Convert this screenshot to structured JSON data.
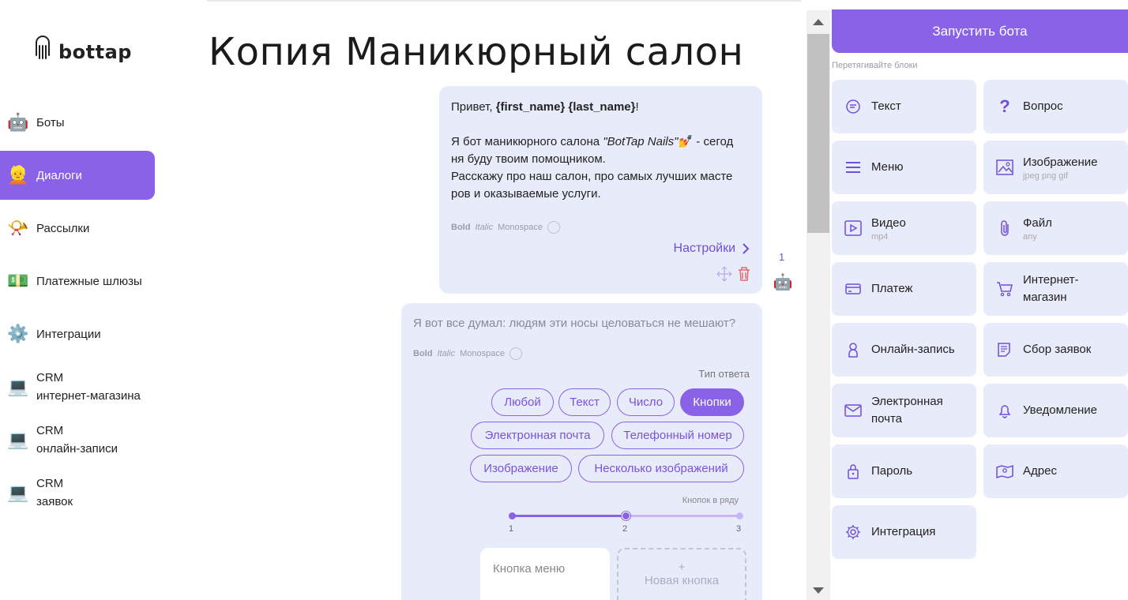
{
  "brand": {
    "name": "bottap"
  },
  "nav": {
    "items": [
      {
        "label": "Боты",
        "icon": "robot-icon"
      },
      {
        "label": "Диалоги",
        "icon": "person-icon",
        "active": true
      },
      {
        "label": "Рассылки",
        "icon": "postal-horn-icon"
      },
      {
        "label": "Платежные шлюзы",
        "icon": "money-icon"
      },
      {
        "label": "Интеграции",
        "icon": "gear-icon"
      },
      {
        "label1": "CRM",
        "label2": "интернет-магазина",
        "icon": "laptop-icon"
      },
      {
        "label1": "CRM",
        "label2": "онлайн-записи",
        "icon": "laptop-icon"
      },
      {
        "label1": "CRM",
        "label2": "заявок",
        "icon": "laptop-icon"
      }
    ]
  },
  "page": {
    "title": "Копия Маникюрный салон"
  },
  "message1": {
    "greet_prefix": "Привет, ",
    "greet_vars": "{first_name} {last_name}",
    "greet_suffix": "!",
    "line2_prefix": "Я бот маникюрного салона ",
    "line2_brand": "\"BotTap Nails\"",
    "line2_emoji": "💅",
    "line2_suffix": "  - сегод",
    "line3": "ня буду твоим помощником.",
    "line4": "Расскажу про наш салон, про самых лучших масте",
    "line5": "ров и оказываемые услуги.",
    "fmt_bold": "Bold",
    "fmt_italic": "Italic",
    "fmt_mono": "Monospace",
    "settings_label": "Настройки",
    "position": "1"
  },
  "message2": {
    "text": "Я вот все думал: людям эти носы целоваться не мешают?",
    "fmt_bold": "Bold",
    "fmt_italic": "Italic",
    "fmt_mono": "Monospace",
    "answer_type_label": "Тип ответа",
    "answer_types": [
      "Любой",
      "Текст",
      "Число",
      "Кнопки",
      "Электронная почта",
      "Телефонный номер",
      "Изображение",
      "Несколько изображений"
    ],
    "selected_answer_type": "Кнопки",
    "per_row_label": "Кнопок в ряду",
    "per_row_ticks": [
      "1",
      "2",
      "3"
    ],
    "per_row_value": 2,
    "button_placeholder": "Кнопка меню",
    "new_button_plus": "+",
    "new_button_label": "Новая кнопка"
  },
  "panel": {
    "run_label": "Запустить бота",
    "drag_hint": "Перетягивайте блоки",
    "blocks": [
      {
        "label": "Текст",
        "icon": "chat-icon"
      },
      {
        "label": "Вопрос",
        "icon": "question-icon"
      },
      {
        "label": "Меню",
        "icon": "menu-icon"
      },
      {
        "label": "Изображение",
        "sub": "jpeg png gif",
        "icon": "image-icon"
      },
      {
        "label": "Видео",
        "sub": "mp4",
        "icon": "video-icon"
      },
      {
        "label": "Файл",
        "sub": "any",
        "icon": "paperclip-icon"
      },
      {
        "label": "Платеж",
        "icon": "card-icon"
      },
      {
        "label": "Интернет-магазин",
        "label1": "Интернет-",
        "label2": "магазин",
        "icon": "cart-icon"
      },
      {
        "label": "Онлайн-запись",
        "icon": "user-badge-icon"
      },
      {
        "label": "Сбор заявок",
        "icon": "form-icon"
      },
      {
        "label": "Электронная почта",
        "label1": "Электронная",
        "label2": "почта",
        "icon": "mail-icon"
      },
      {
        "label": "Уведомление",
        "icon": "bell-icon"
      },
      {
        "label": "Пароль",
        "icon": "lock-icon"
      },
      {
        "label": "Адрес",
        "icon": "map-icon"
      },
      {
        "label": "Интеграция",
        "icon": "gear-icon"
      }
    ]
  },
  "colors": {
    "accent": "#8a62e8",
    "card_bg": "#e8ecfa"
  }
}
